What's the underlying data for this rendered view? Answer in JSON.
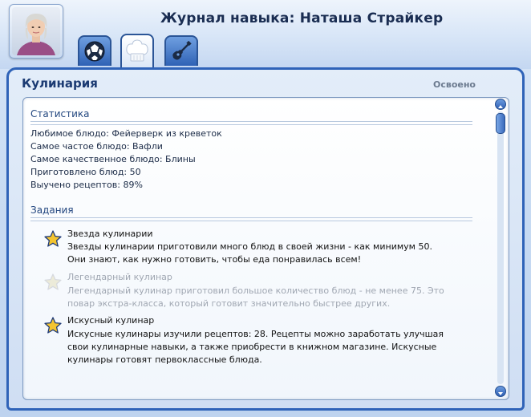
{
  "window": {
    "title_prefix": "Журнал навыка",
    "title_separator": ": ",
    "title_name": "Наташа Страйкер"
  },
  "tabs": [
    {
      "icon": "soccer-ball-icon",
      "active": false
    },
    {
      "icon": "chef-hat-icon",
      "active": true
    },
    {
      "icon": "guitar-icon",
      "active": false
    }
  ],
  "skill": {
    "name": "Кулинария",
    "status": "Освоено"
  },
  "statistics": {
    "heading": "Статистика",
    "items": [
      "Любимое блюдо: Фейерверк из креветок",
      "Самое частое блюдо: Вафли",
      "Самое качественное блюдо: Блины",
      "Приготовлено блюд: 50",
      "Выучено рецептов: 89%"
    ]
  },
  "tasks": {
    "heading": "Задания",
    "items": [
      {
        "name": "Звезда кулинарии",
        "lines": [
          "Звезды кулинарии приготовили много блюд в своей жизни - как минимум 50.",
          "Они знают, как нужно готовить, чтобы еда понравилась всем!"
        ],
        "completed": true
      },
      {
        "name": "Легендарный кулинар",
        "lines": [
          "Легендарный кулинар приготовил большое количество блюд - не менее 75. Это",
          "повар экстра-класса, который готовит значительно быстрее других."
        ],
        "completed": false
      },
      {
        "name": "Искусный кулинар",
        "lines": [
          "Искусные кулинары изучили рецептов: 28. Рецепты можно заработать улучшая",
          "свои кулинарные навыки, а также приобрести в книжном магазине. Искусные",
          "кулинары готовят первоклассные блюда."
        ],
        "completed": true
      }
    ]
  },
  "colors": {
    "accent": "#2f63b8",
    "star_gold": "#f4c430",
    "star_faded": "#e8e6d2"
  }
}
